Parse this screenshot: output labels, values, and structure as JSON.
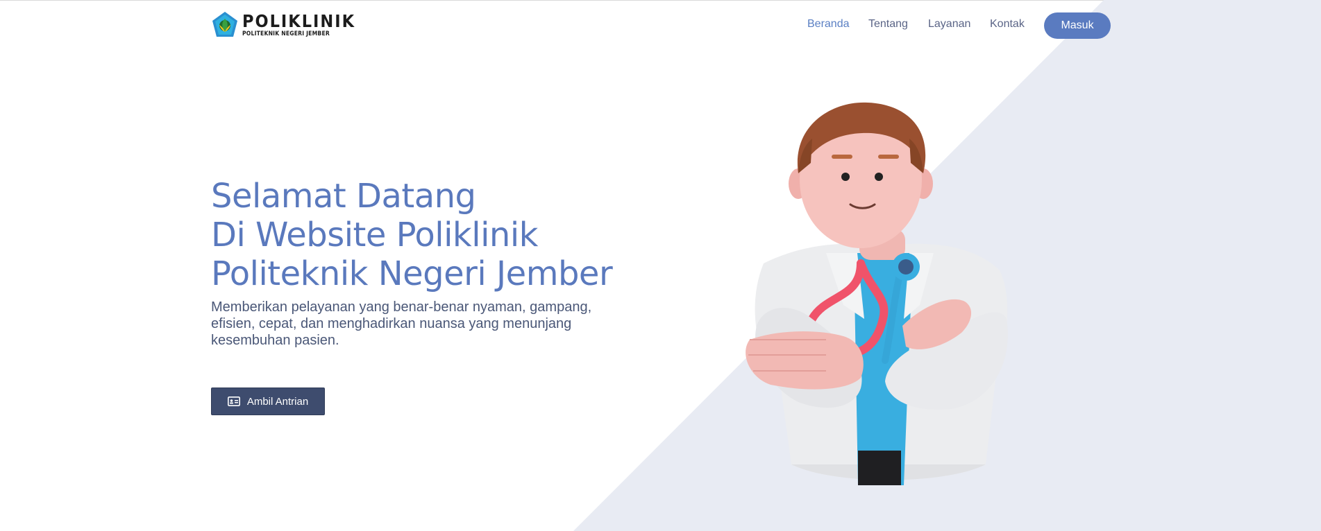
{
  "logo": {
    "title": "POLIKLINIK",
    "subtitle": "POLITEKNIK NEGERI JEMBER",
    "emblem_icon": "polije-emblem-icon"
  },
  "nav": {
    "links": [
      "Beranda",
      "Tentang",
      "Layanan",
      "Kontak"
    ],
    "active": "Beranda",
    "login_label": "Masuk"
  },
  "hero": {
    "title_lines": [
      "Selamat Datang",
      "Di Website Poliklinik",
      "Politeknik Negeri Jember"
    ],
    "description": "Memberikan pelayanan yang benar-benar nyaman, gampang, efisien, cepat, dan menghadirkan nuansa yang menunjang kesembuhan pasien.",
    "cta_label": "Ambil Antrian",
    "cta_icon": "id-card-icon"
  },
  "illustration": "doctor-illustration",
  "colors": {
    "accent": "#5a7bc0",
    "title": "#5a79bd",
    "cta_bg": "#3e4c6e",
    "panel_bg": "#e8ebf3"
  }
}
